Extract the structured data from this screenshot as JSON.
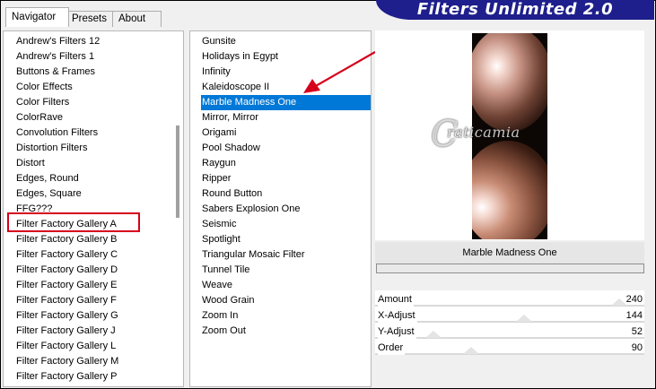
{
  "tabs": [
    {
      "label": "Navigator",
      "active": true
    },
    {
      "label": "Presets",
      "active": false
    },
    {
      "label": "About",
      "active": false
    }
  ],
  "banner": "Filters Unlimited 2.0",
  "categories": [
    "Andrew's Filters 12",
    "Andrew's Filters 1",
    "Buttons & Frames",
    "Color Effects",
    "Color Filters",
    "ColorRave",
    "Convolution Filters",
    "Distortion Filters",
    "Distort",
    "Edges, Round",
    "Edges, Square",
    "FFG???",
    "Filter Factory Gallery A",
    "Filter Factory Gallery B",
    "Filter Factory Gallery C",
    "Filter Factory Gallery D",
    "Filter Factory Gallery E",
    "Filter Factory Gallery F",
    "Filter Factory Gallery G",
    "Filter Factory Gallery J",
    "Filter Factory Gallery L",
    "Filter Factory Gallery M",
    "Filter Factory Gallery P"
  ],
  "highlighted_category": "Filter Factory Gallery A",
  "filters": [
    "Gunsite",
    "Holidays in Egypt",
    "Infinity",
    "Kaleidoscope II",
    "Marble Madness One",
    "Mirror, Mirror",
    "Origami",
    "Pool Shadow",
    "Raygun",
    "Ripper",
    "Round Button",
    "Sabers Explosion One",
    "Seismic",
    "Spotlight",
    "Triangular Mosaic Filter",
    "Tunnel Tile",
    "Weave",
    "Wood Grain",
    "Zoom In",
    "Zoom Out"
  ],
  "selected_filter": "Marble Madness One",
  "preview": {
    "filter_name": "Marble Madness One",
    "watermark": "raticamia"
  },
  "params": [
    {
      "label": "Amount",
      "value": "240",
      "fraction": 0.94
    },
    {
      "label": "X-Adjust",
      "value": "144",
      "fraction": 0.56
    },
    {
      "label": "Y-Adjust",
      "value": "52",
      "fraction": 0.2
    },
    {
      "label": "Order",
      "value": "90",
      "fraction": 0.35
    }
  ],
  "colors": {
    "selection": "#0078d7",
    "banner": "#1e1e8c",
    "highlight_box": "#d6001c",
    "arrow": "#d6001c"
  }
}
